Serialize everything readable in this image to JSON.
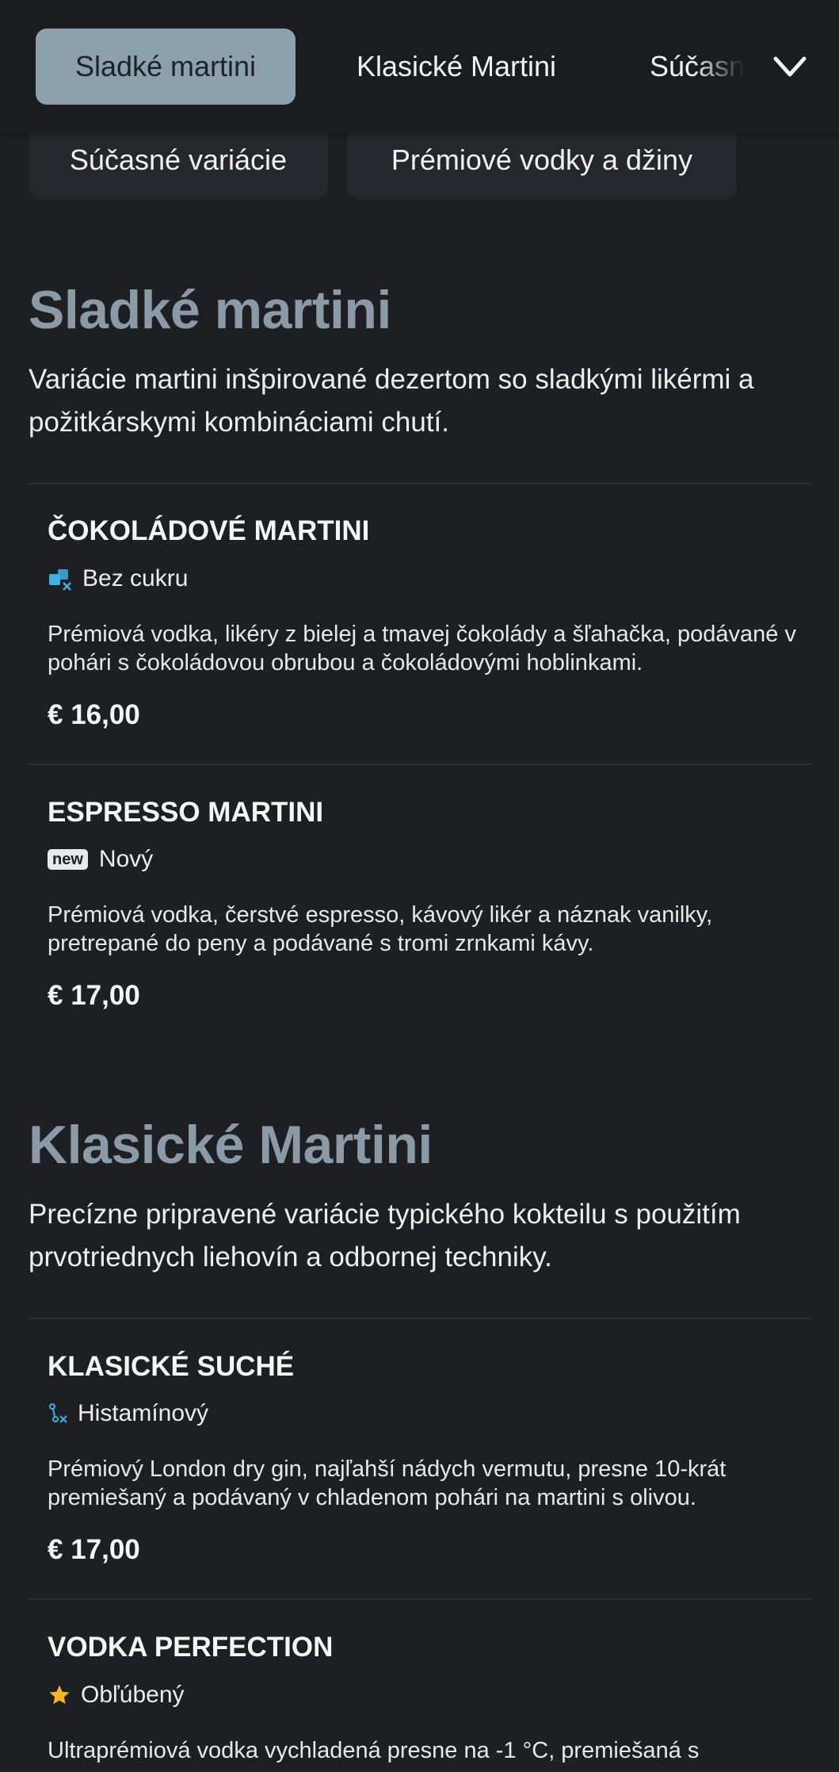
{
  "nav": {
    "tabs": [
      {
        "label": "Sladké martini"
      },
      {
        "label": "Klasické Martini"
      },
      {
        "label": "Súčasné variácie"
      }
    ],
    "pills": [
      {
        "label": "Súčasné variácie"
      },
      {
        "label": "Prémiové vodky a džiny"
      }
    ]
  },
  "sections": [
    {
      "title": "Sladké martini",
      "description": "Variácie martini inšpirované dezertom so sladkými likérmi a požitkárskymi kombináciami chutí.",
      "items": [
        {
          "name": "ČOKOLÁDOVÉ MARTINI",
          "badge": "Bez cukru",
          "badge_icon": "sugar-free-icon",
          "description": "Prémiová vodka, likéry z bielej a tmavej čokolády a šľahačka, podávané v pohári s čokoládovou obrubou a čokoládovými hoblinkami.",
          "price": "€ 16,00"
        },
        {
          "name": "ESPRESSO MARTINI",
          "badge_tag": "new",
          "badge": "Nový",
          "badge_icon": "new-tag-icon",
          "description": "Prémiová vodka, čerstvé espresso, kávový likér a náznak vanilky, pretrepané do peny a podávané s tromi zrnkami kávy.",
          "price": "€ 17,00"
        }
      ]
    },
    {
      "title": "Klasické Martini",
      "description": "Precízne pripravené variácie typického kokteilu s použitím prvotriednych liehovín a odbornej techniky.",
      "items": [
        {
          "name": "KLASICKÉ SUCHÉ",
          "badge": "Histamínový",
          "badge_icon": "histamine-icon",
          "description": "Prémiový London dry gin, najľahší nádych vermutu, presne 10-krát premiešaný a podávaný v chladenom pohári na martini s olivou.",
          "price": "€ 17,00"
        },
        {
          "name": "VODKA PERFECTION",
          "badge": "Obľúbený",
          "badge_icon": "star-icon",
          "description": "Ultraprémiová vodka vychladená presne na -1 °C, premiešaná s"
        }
      ]
    }
  ],
  "colors": {
    "background": "#1d1f23",
    "active_tab": "#8da0ae",
    "section_title": "#8a9aa6",
    "icon_blue": "#3fb0e6",
    "star": "#f5b91f"
  }
}
